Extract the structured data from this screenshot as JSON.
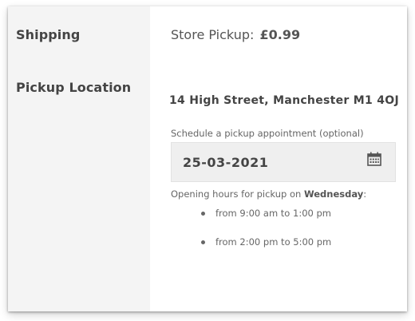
{
  "labels": {
    "shipping": "Shipping",
    "pickup_location": "Pickup Location"
  },
  "shipping": {
    "method": "Store Pickup:",
    "price": "£0.99"
  },
  "pickup": {
    "address": "14 High Street, Manchester M1 4OJ",
    "schedule_label": "Schedule a pickup appointment (optional)",
    "date_value": "25-03-2021",
    "calendar_icon": "calendar-icon",
    "hours_prefix": "Opening hours for pickup on ",
    "hours_day": "Wednesday",
    "hours_suffix": ":",
    "hours": [
      "from 9:00 am to 1:00 pm",
      "from 2:00 pm to 5:00 pm"
    ]
  }
}
